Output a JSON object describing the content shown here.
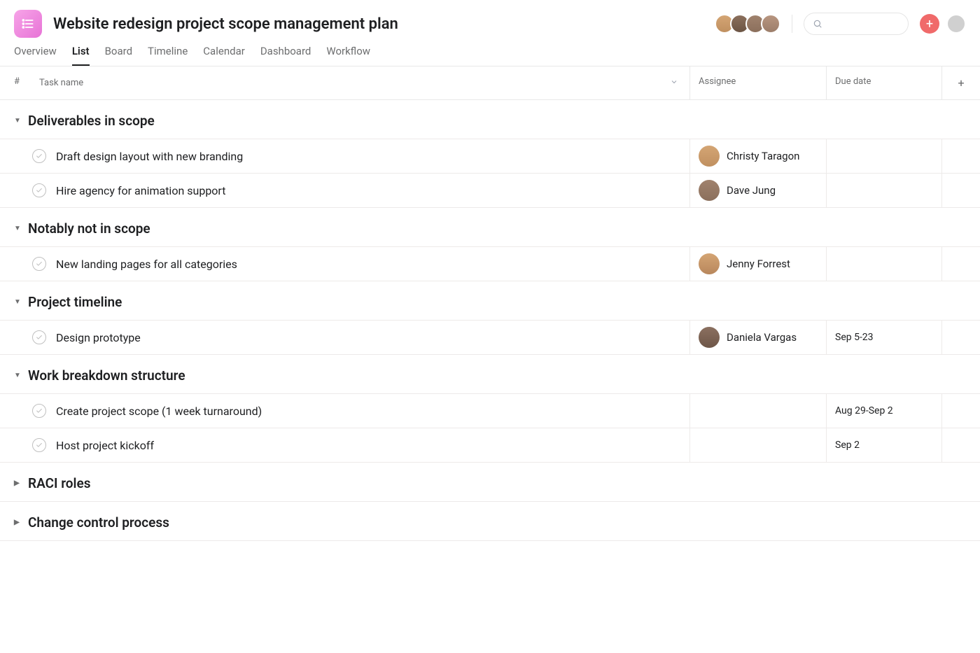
{
  "project": {
    "title": "Website redesign project scope management plan"
  },
  "tabs": {
    "items": [
      {
        "label": "Overview"
      },
      {
        "label": "List"
      },
      {
        "label": "Board"
      },
      {
        "label": "Timeline"
      },
      {
        "label": "Calendar"
      },
      {
        "label": "Dashboard"
      },
      {
        "label": "Workflow"
      }
    ],
    "active": "List"
  },
  "columns": {
    "num": "#",
    "task": "Task name",
    "assignee": "Assignee",
    "due": "Due date"
  },
  "sections": [
    {
      "title": "Deliverables in scope",
      "expanded": true,
      "tasks": [
        {
          "name": "Draft design layout with new branding",
          "assignee": "Christy Taragon",
          "due": ""
        },
        {
          "name": "Hire agency for animation support",
          "assignee": "Dave Jung",
          "due": ""
        }
      ]
    },
    {
      "title": "Notably not in scope",
      "expanded": true,
      "tasks": [
        {
          "name": "New landing pages for all categories",
          "assignee": "Jenny Forrest",
          "due": ""
        }
      ]
    },
    {
      "title": "Project timeline",
      "expanded": true,
      "tasks": [
        {
          "name": "Design prototype",
          "assignee": "Daniela Vargas",
          "due": "Sep 5-23"
        }
      ]
    },
    {
      "title": "Work breakdown structure",
      "expanded": true,
      "tasks": [
        {
          "name": "Create project scope (1 week turnaround)",
          "assignee": "",
          "due": "Aug 29-Sep 2"
        },
        {
          "name": "Host project kickoff",
          "assignee": "",
          "due": "Sep 2"
        }
      ]
    },
    {
      "title": "RACI roles",
      "expanded": false,
      "tasks": []
    },
    {
      "title": "Change control process",
      "expanded": false,
      "tasks": []
    }
  ],
  "avatar_classes": {
    "Christy Taragon": "av-1",
    "Dave Jung": "av-3",
    "Jenny Forrest": "av-jenny",
    "Daniela Vargas": "av-daniela"
  }
}
